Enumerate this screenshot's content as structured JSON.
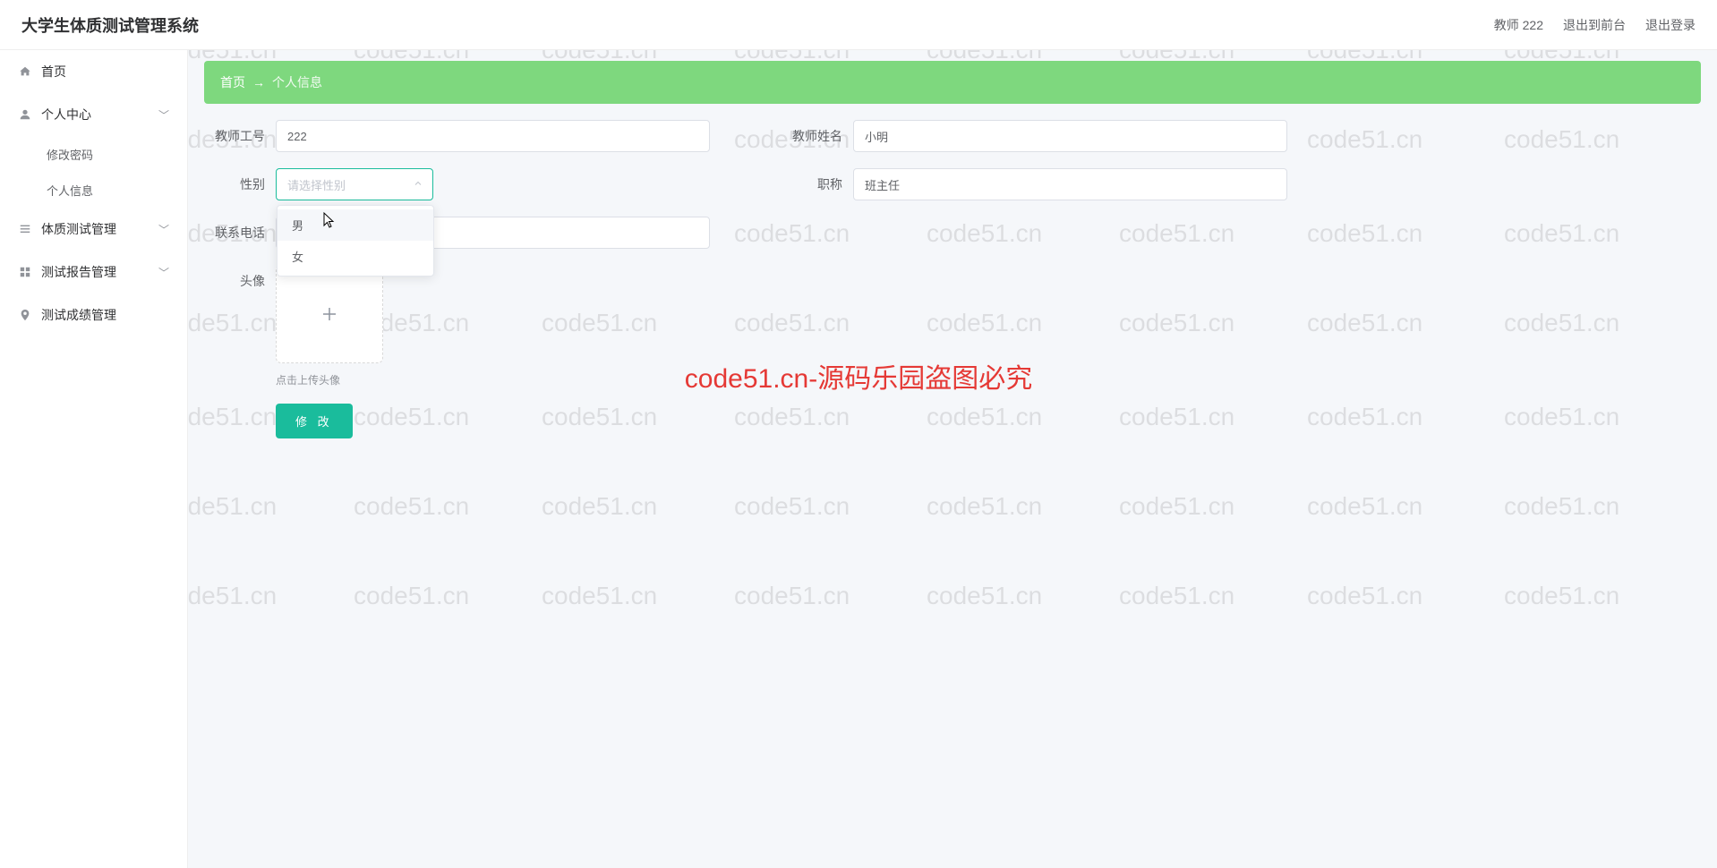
{
  "header": {
    "title": "大学生体质测试管理系统",
    "user_role": "教师 222",
    "exit_front": "退出到前台",
    "logout": "退出登录"
  },
  "sidebar": {
    "home": "首页",
    "personal_center": "个人中心",
    "change_password": "修改密码",
    "personal_info": "个人信息",
    "fitness_test_mgmt": "体质测试管理",
    "test_report_mgmt": "测试报告管理",
    "test_score_mgmt": "测试成绩管理"
  },
  "breadcrumb": {
    "home": "首页",
    "arrow": "→",
    "current": "个人信息"
  },
  "form": {
    "teacher_id_label": "教师工号",
    "teacher_id_value": "222",
    "teacher_name_label": "教师姓名",
    "teacher_name_value": "小明",
    "gender_label": "性别",
    "gender_placeholder": "请选择性别",
    "gender_options": {
      "male": "男",
      "female": "女"
    },
    "title_label": "职称",
    "title_value": "班主任",
    "phone_label": "联系电话",
    "phone_value": "",
    "avatar_label": "头像",
    "upload_hint": "点击上传头像",
    "submit": "修 改"
  },
  "watermark": {
    "small": "code51.cn",
    "center": "code51.cn-源码乐园盗图必究"
  }
}
